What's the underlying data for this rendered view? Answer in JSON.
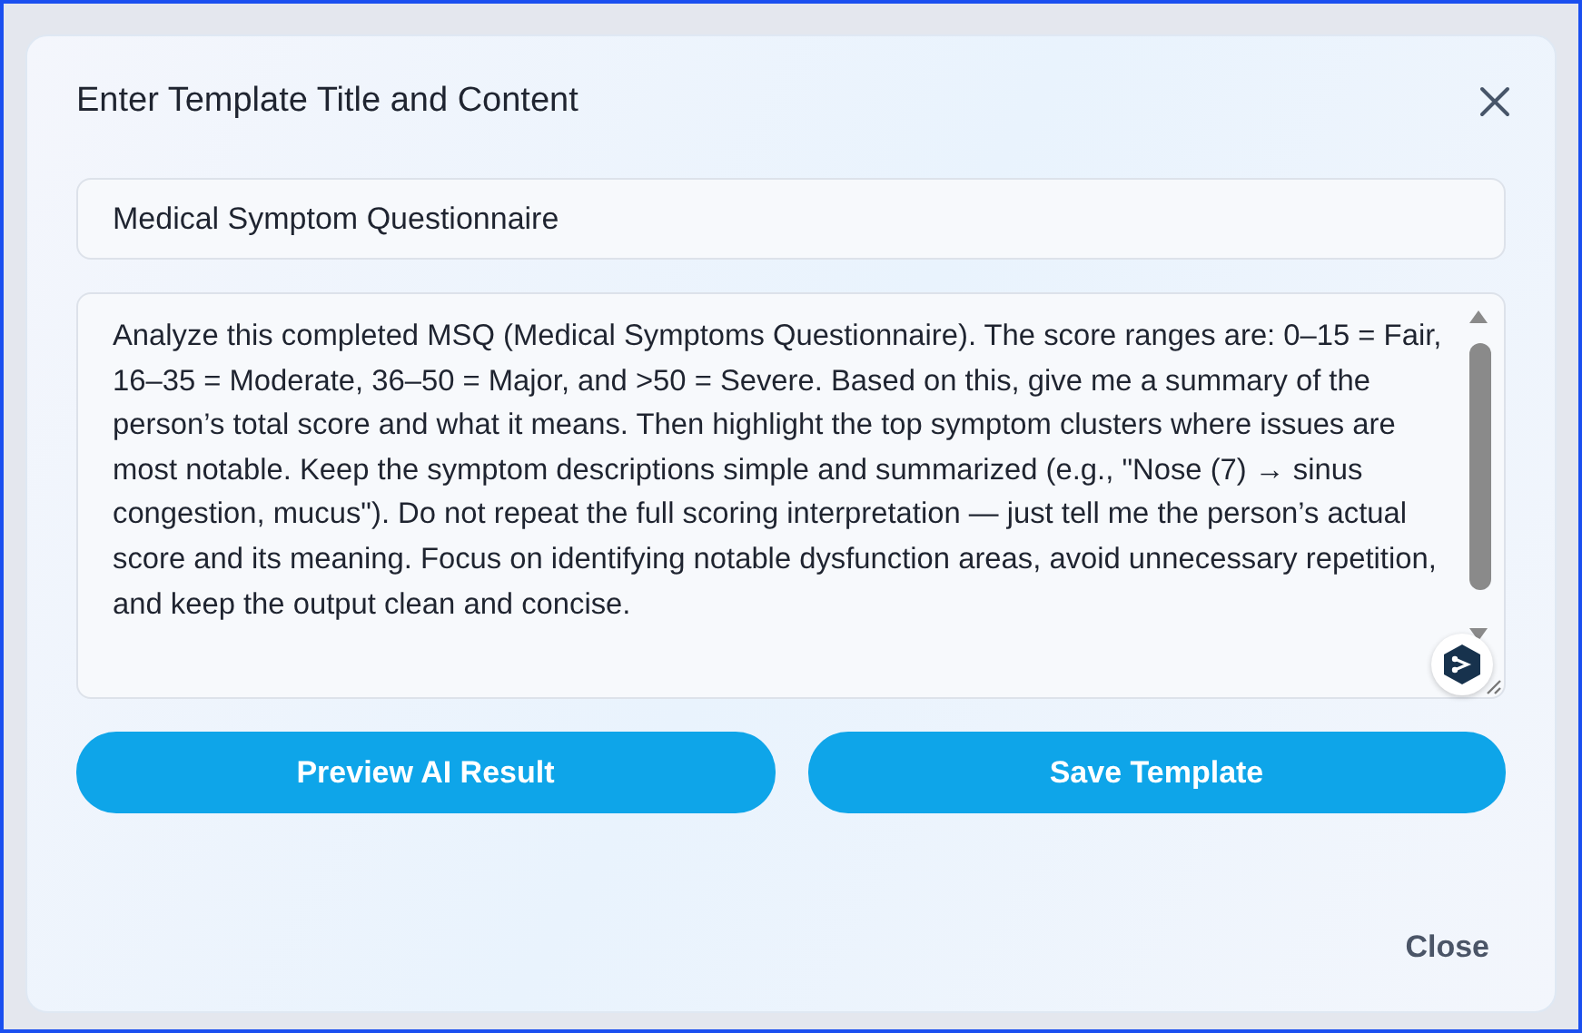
{
  "dialog": {
    "title": "Enter Template Title and Content",
    "title_field": {
      "value": "Medical Symptom Questionnaire"
    },
    "content_field": {
      "value": "Analyze this completed MSQ (Medical Symptoms Questionnaire). The score ranges are: 0–15 = Fair, 16–35 = Moderate, 36–50 = Major, and >50 = Severe. Based on this, give me a summary of the person’s total score and what it means. Then highlight the top symptom clusters where issues are most notable. Keep the symptom descriptions simple and summarized (e.g., \"Nose (7) → sinus congestion, mucus\"). Do not repeat the full scoring interpretation — just tell me the person’s actual score and its meaning. Focus on identifying notable dysfunction areas, avoid unnecessary repetition, and keep the output clean and concise."
    },
    "actions": [
      {
        "label": "Preview AI Result",
        "kind": "primary"
      },
      {
        "label": "Save Template",
        "kind": "primary"
      }
    ],
    "footer_button": {
      "label": "Close"
    }
  }
}
